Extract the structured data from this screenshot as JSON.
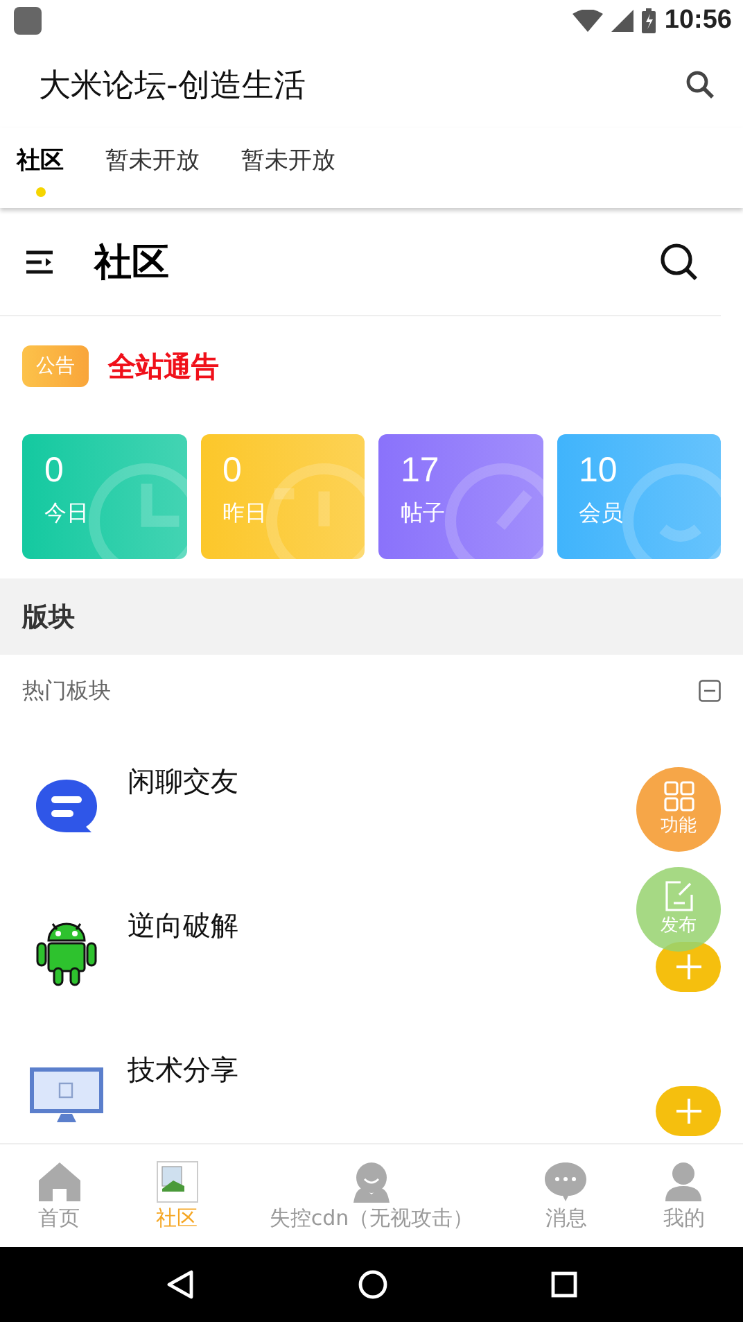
{
  "status_bar": {
    "time": "10:56"
  },
  "app_bar": {
    "title": "大米论坛-创造生活"
  },
  "tabs": [
    {
      "label": "社区",
      "selected": true
    },
    {
      "label": "暂未开放",
      "selected": false
    },
    {
      "label": "暂未开放",
      "selected": false
    }
  ],
  "page_header": {
    "title": "社区"
  },
  "notice": {
    "badge": "公告",
    "text": "全站通告"
  },
  "stats": [
    {
      "value": "0",
      "label": "今日",
      "color": "#14c9a0",
      "kind": "clock"
    },
    {
      "value": "0",
      "label": "昨日",
      "color": "#fcc72a",
      "kind": "history"
    },
    {
      "value": "17",
      "label": "帖子",
      "color": "#8a72fb",
      "kind": "gauge"
    },
    {
      "value": "10",
      "label": "会员",
      "color": "#40b4fc",
      "kind": "smile"
    }
  ],
  "section": {
    "title": "版块"
  },
  "hot_group": {
    "title": "热门板块",
    "expanded": true
  },
  "forums": [
    {
      "name": "闲聊交友",
      "kind": "chat",
      "follow_button": false
    },
    {
      "name": "逆向破解",
      "kind": "android",
      "follow_button": true
    },
    {
      "name": "技术分享",
      "kind": "monitor",
      "follow_button": true
    }
  ],
  "fabs": [
    {
      "label": "功能",
      "kind": "grid"
    },
    {
      "label": "发布",
      "kind": "edit"
    }
  ],
  "bottom_nav": [
    {
      "label": "首页",
      "kind": "home",
      "selected": false
    },
    {
      "label": "社区",
      "kind": "broken",
      "selected": true
    },
    {
      "label": "失控cdn（无视攻击）",
      "kind": "face",
      "selected": false
    },
    {
      "label": "消息",
      "kind": "message",
      "selected": false
    },
    {
      "label": "我的",
      "kind": "person",
      "selected": false
    }
  ]
}
